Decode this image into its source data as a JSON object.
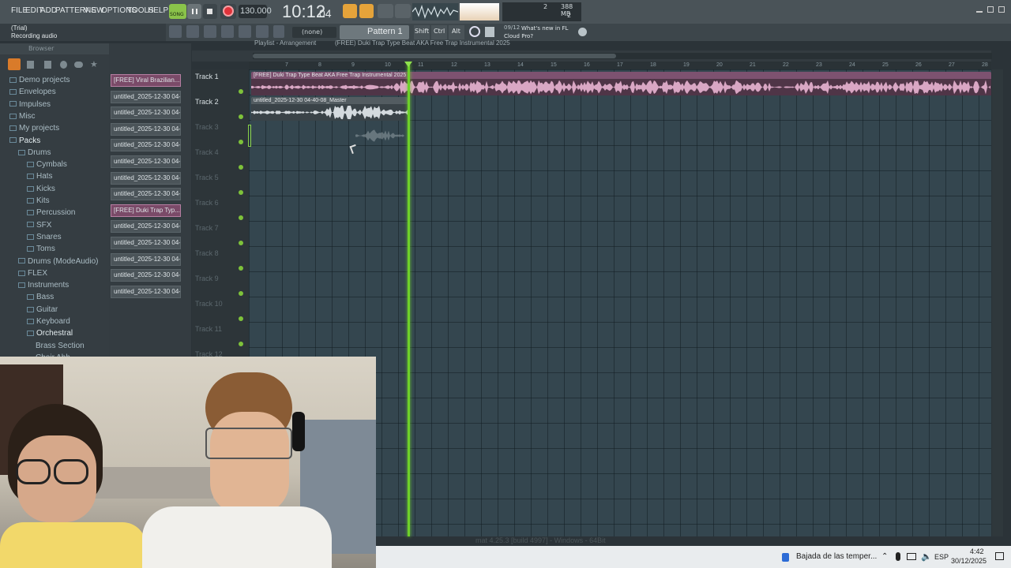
{
  "menu": [
    "FILE",
    "EDIT",
    "ADD",
    "PATTERNS",
    "VIEW",
    "OPTIONS",
    "TOOLS",
    "HELP"
  ],
  "transport": {
    "song_label": "SONG",
    "tempo": "130.000",
    "time": "10:12",
    "time_sub": "04",
    "time_ms": "B:S:T"
  },
  "status": {
    "cpu_value": "2",
    "memory": "388 MB",
    "voices": "2"
  },
  "hint": {
    "line1": "(Trial)",
    "line2": "Recording audio"
  },
  "toolbar": {
    "snap": "(none)",
    "pattern": "Pattern 1",
    "shift": "Shift",
    "ctrl": "Ctrl",
    "alt": "Alt",
    "news_index": "09/12",
    "news_text": "What's new in FL Cloud Pro?"
  },
  "playlist": {
    "title": "Playlist - Arrangement",
    "clip_path": "(FREE) Duki Trap Type Beat AKA  Free Trap Instrumental 2025"
  },
  "browser": {
    "header": "Browser",
    "items": [
      {
        "label": "Demo projects",
        "indent": 0
      },
      {
        "label": "Envelopes",
        "indent": 0
      },
      {
        "label": "Impulses",
        "indent": 0
      },
      {
        "label": "Misc",
        "indent": 0
      },
      {
        "label": "My projects",
        "indent": 0
      },
      {
        "label": "Packs",
        "indent": 0
      },
      {
        "label": "Drums",
        "indent": 1
      },
      {
        "label": "Cymbals",
        "indent": 2
      },
      {
        "label": "Hats",
        "indent": 2
      },
      {
        "label": "Kicks",
        "indent": 2
      },
      {
        "label": "Kits",
        "indent": 2
      },
      {
        "label": "Percussion",
        "indent": 2
      },
      {
        "label": "SFX",
        "indent": 2
      },
      {
        "label": "Snares",
        "indent": 2
      },
      {
        "label": "Toms",
        "indent": 2
      },
      {
        "label": "Drums (ModeAudio)",
        "indent": 1
      },
      {
        "label": "FLEX",
        "indent": 1
      },
      {
        "label": "Instruments",
        "indent": 1
      },
      {
        "label": "Bass",
        "indent": 2
      },
      {
        "label": "Guitar",
        "indent": 2
      },
      {
        "label": "Keyboard",
        "indent": 2
      },
      {
        "label": "Orchestral",
        "indent": 2
      },
      {
        "label": "Brass Section",
        "indent": 3
      },
      {
        "label": "Choir Ahh",
        "indent": 3
      }
    ]
  },
  "patterns": [
    {
      "label": "[FREE] Viral Brazilian...",
      "pink": true
    },
    {
      "label": "untitled_2025-12-30 04-...",
      "pink": false
    },
    {
      "label": "untitled_2025-12-30 04-...",
      "pink": false
    },
    {
      "label": "untitled_2025-12-30 04-...",
      "pink": false
    },
    {
      "label": "untitled_2025-12-30 04-...",
      "pink": false
    },
    {
      "label": "untitled_2025-12-30 04-...",
      "pink": false
    },
    {
      "label": "untitled_2025-12-30 04-...",
      "pink": false
    },
    {
      "label": "untitled_2025-12-30 04-...",
      "pink": false
    },
    {
      "label": "[FREE] Duki Trap Typ...",
      "pink": true
    },
    {
      "label": "untitled_2025-12-30 04-...",
      "pink": false
    },
    {
      "label": "untitled_2025-12-30 04-...",
      "pink": false
    },
    {
      "label": "untitled_2025-12-30 04-...",
      "pink": false
    },
    {
      "label": "untitled_2025-12-30 04-...",
      "pink": false
    },
    {
      "label": "untitled_2025-12-30 04-...",
      "pink": false
    }
  ],
  "tracks": [
    "Track 1",
    "Track 2",
    "Track 3",
    "Track 4",
    "Track 5",
    "Track 6",
    "Track 7",
    "Track 8",
    "Track 9",
    "Track 10",
    "Track 11",
    "Track 12"
  ],
  "ruler": [
    "7",
    "8",
    "9",
    "10",
    "11",
    "12",
    "13",
    "14",
    "15",
    "16",
    "17",
    "18",
    "19",
    "20",
    "21",
    "22",
    "23",
    "24",
    "25",
    "26",
    "27",
    "28"
  ],
  "clips": {
    "clip1": "[FREE] Duki Trap Type Beat AKA  Free Trap Instrumental 2025",
    "clip2": "untitled_2025-12-30 04-40-08_Master"
  },
  "taskbar": {
    "weather": "Bajada de las temper...",
    "lang": "ESP",
    "time": "4:42",
    "date": "30/12/2025"
  },
  "bottom_caption": "mat 4.25.3 [build 4997] - Windows - 64Bit",
  "colors": {
    "accent_green": "#6ed12a",
    "clip_pink": "#d9a7c4",
    "record_red": "#e0323a"
  }
}
